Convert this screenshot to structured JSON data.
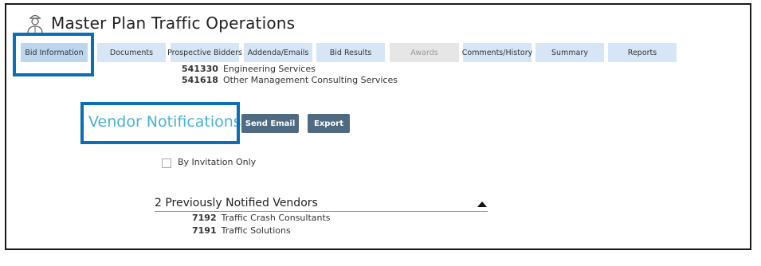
{
  "page": {
    "title": "Master Plan Traffic Operations",
    "icon": "engineer-user-icon"
  },
  "tabs": [
    {
      "label": "Bid Information",
      "state": "active"
    },
    {
      "label": "Documents",
      "state": "normal"
    },
    {
      "label": "Prospective Bidders",
      "state": "normal"
    },
    {
      "label": "Addenda/Emails",
      "state": "normal"
    },
    {
      "label": "Bid Results",
      "state": "normal"
    },
    {
      "label": "Awards",
      "state": "disabled"
    },
    {
      "label": "Comments/History",
      "state": "normal"
    },
    {
      "label": "Summary",
      "state": "normal"
    },
    {
      "label": "Reports",
      "state": "normal"
    }
  ],
  "naics_codes": [
    {
      "code": "541330",
      "description": "Engineering Services"
    },
    {
      "code": "541618",
      "description": "Other Management Consulting Services"
    }
  ],
  "vendor_notifications": {
    "title": "Vendor Notifications",
    "send_email_label": "Send Email",
    "export_label": "Export",
    "by_invitation_label": "By Invitation Only",
    "by_invitation_checked": false
  },
  "previously_notified": {
    "header": "2 Previously Notified Vendors",
    "vendors": [
      {
        "id": "7192",
        "name": "Traffic Crash Consultants"
      },
      {
        "id": "7191",
        "name": "Traffic Solutions"
      }
    ]
  },
  "colors": {
    "tab_bg": "#d6e6f6",
    "highlight": "#0a6fb7",
    "button": "#4f6b82",
    "section_title": "#4ab0d8"
  }
}
